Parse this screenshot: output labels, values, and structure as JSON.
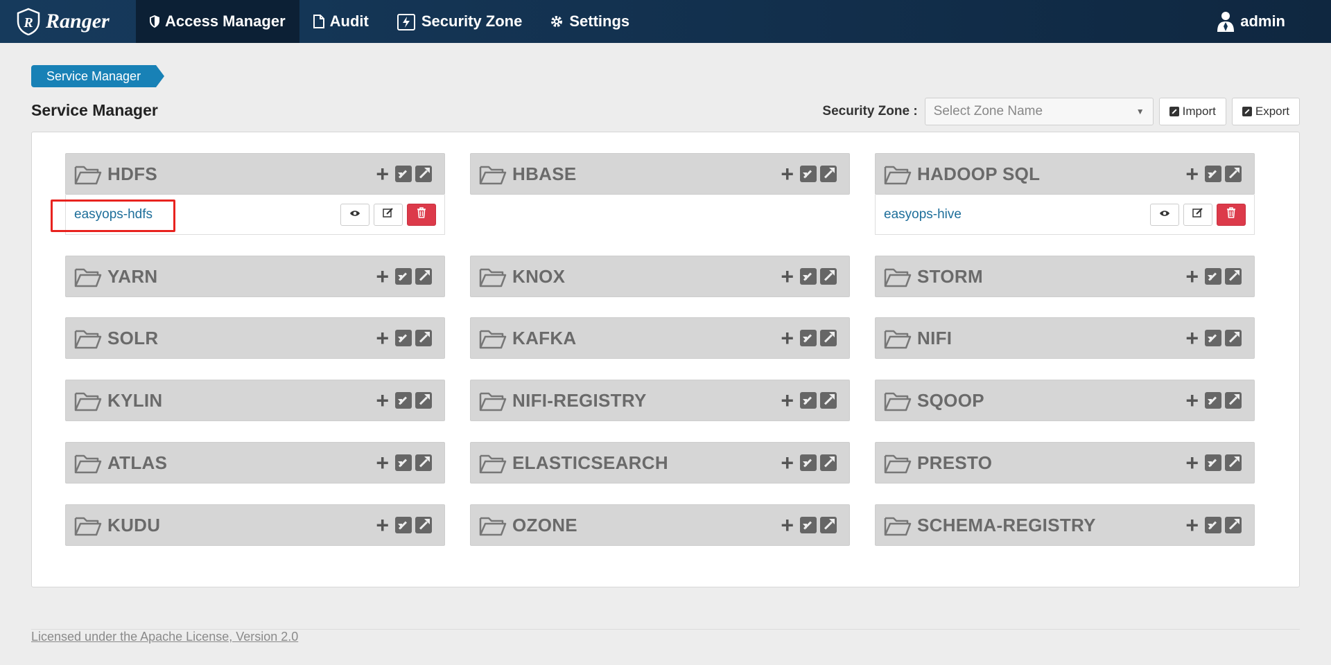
{
  "navbar": {
    "brand": "Ranger",
    "items": [
      {
        "label": "Access Manager",
        "icon": "shield-icon"
      },
      {
        "label": "Audit",
        "icon": "file-icon"
      },
      {
        "label": "Security Zone",
        "icon": "zone-icon"
      },
      {
        "label": "Settings",
        "icon": "gear-icon"
      }
    ],
    "user": "admin"
  },
  "breadcrumb": "Service Manager",
  "page_title": "Service Manager",
  "zone": {
    "label": "Security Zone :",
    "placeholder": "Select Zone Name",
    "import_label": "Import",
    "export_label": "Export"
  },
  "services": [
    {
      "name": "HDFS",
      "instances": [
        "easyops-hdfs"
      ]
    },
    {
      "name": "HBASE",
      "instances": []
    },
    {
      "name": "HADOOP SQL",
      "instances": [
        "easyops-hive"
      ]
    },
    {
      "name": "YARN",
      "instances": []
    },
    {
      "name": "KNOX",
      "instances": []
    },
    {
      "name": "STORM",
      "instances": []
    },
    {
      "name": "SOLR",
      "instances": []
    },
    {
      "name": "KAFKA",
      "instances": []
    },
    {
      "name": "NIFI",
      "instances": []
    },
    {
      "name": "KYLIN",
      "instances": []
    },
    {
      "name": "NIFI-REGISTRY",
      "instances": []
    },
    {
      "name": "SQOOP",
      "instances": []
    },
    {
      "name": "ATLAS",
      "instances": []
    },
    {
      "name": "ELASTICSEARCH",
      "instances": []
    },
    {
      "name": "PRESTO",
      "instances": []
    },
    {
      "name": "KUDU",
      "instances": []
    },
    {
      "name": "OZONE",
      "instances": []
    },
    {
      "name": "SCHEMA-REGISTRY",
      "instances": []
    }
  ],
  "footer": "Licensed under the Apache License, Version 2.0",
  "colors": {
    "navbar": "#163a5c",
    "breadcrumb": "#1881b6",
    "link": "#1d6e9a",
    "delete": "#dc3a4a",
    "highlight": "#e8231f"
  }
}
